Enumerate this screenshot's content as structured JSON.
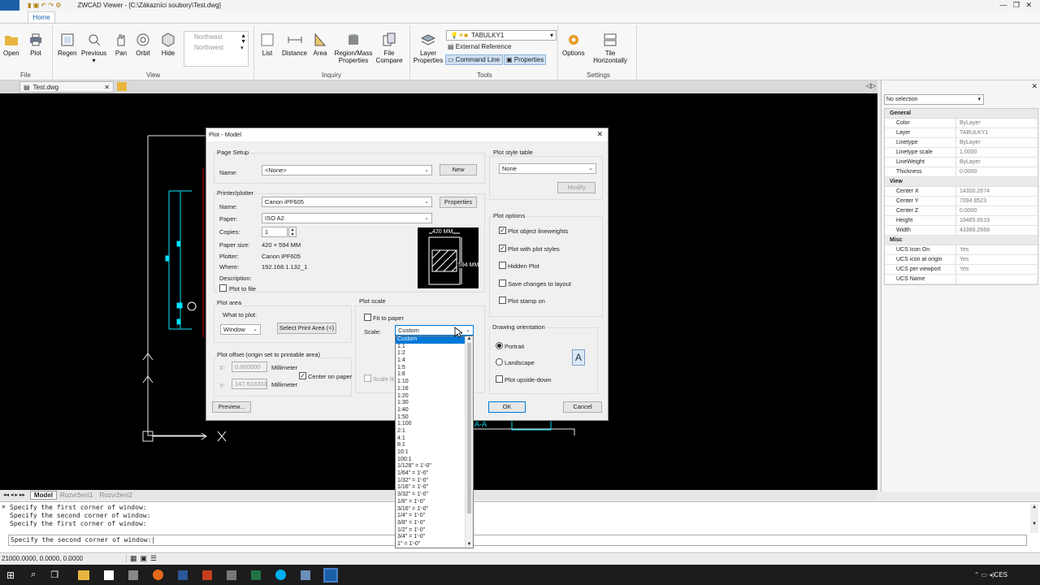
{
  "window": {
    "title": "ZWCAD Viewer - [C:\\Zákazníci soubory\\Test.dwg]"
  },
  "ribbon": {
    "tab": "Home",
    "buttons": {
      "open": "Open",
      "plot": "Plot",
      "regen": "Regen",
      "previous": "Previous",
      "pan": "Pan",
      "orbit": "Orbit",
      "hide": "Hide",
      "list": "List",
      "distance": "Distance",
      "area": "Area",
      "region_mass": "Region/Mass\nProperties",
      "file_compare": "File\nCompare",
      "layer_properties": "Layer\nProperties",
      "options": "Options",
      "tile": "Tile\nHorizontally"
    },
    "views": [
      "Northeast",
      "Northwest"
    ],
    "layer_value": "TABULKY1",
    "external_reference": "External Reference",
    "command_line": "Command Line",
    "properties": "Properties",
    "groups": {
      "file": "File",
      "view": "View",
      "inquiry": "Inquiry",
      "tools": "Tools",
      "settings": "Settings"
    }
  },
  "doc_tab": "Test.dwg",
  "properties_panel": {
    "selection": "No selection",
    "sections": [
      {
        "name": "General",
        "rows": [
          [
            "Color",
            "ByLayer"
          ],
          [
            "Layer",
            "TABULKY1"
          ],
          [
            "Linetype",
            "ByLayer"
          ],
          [
            "Linetype scale",
            "1.0000"
          ],
          [
            "LineWeight",
            "ByLayer"
          ],
          [
            "Thickness",
            "0.0000"
          ]
        ]
      },
      {
        "name": "View",
        "rows": [
          [
            "Center X",
            "14300.2674"
          ],
          [
            "Center Y",
            "7094.8523"
          ],
          [
            "Center Z",
            "0.0000"
          ],
          [
            "Height",
            "19465.6519"
          ],
          [
            "Width",
            "43388.2668"
          ]
        ]
      },
      {
        "name": "Misc",
        "rows": [
          [
            "UCS Icon On",
            "Yes"
          ],
          [
            "UCS icon at origin",
            "Yes"
          ],
          [
            "UCS per viewport",
            "Yes"
          ],
          [
            "UCS Name",
            ""
          ]
        ]
      }
    ]
  },
  "layout_tabs": [
    "Model",
    "Rozvržení1",
    "Rozvržení2"
  ],
  "command": {
    "history": [
      "Specify the first corner of window:",
      "Specify the second corner of window:",
      "Specify the first corner of window:"
    ],
    "prompt": "Specify the second corner of window:"
  },
  "status": {
    "coords": "21000.0000, 0.0000, 0.0000"
  },
  "dialog": {
    "title": "Plot - Model",
    "page_setup": {
      "group": "Page Setup",
      "name_label": "Name:",
      "name_value": "<None>",
      "new_btn": "New"
    },
    "printer": {
      "group": "Printer/plotter",
      "name_label": "Name:",
      "name_value": "Canon iPF605",
      "properties_btn": "Properties",
      "paper_label": "Paper:",
      "paper_value": "ISO A2",
      "copies_label": "Copies:",
      "copies_value": "1",
      "size_label": "Paper size:",
      "size_value": "420 × 594  MM",
      "plotter_label": "Plotter:",
      "plotter_value": "Canon iPF605",
      "where_label": "Where:",
      "where_value": "192.168.1.132_1",
      "desc_label": "Description:",
      "plot_to_file": "Plot to file",
      "preview_w": "420 MM",
      "preview_h": "594 MM"
    },
    "plot_area": {
      "group": "Plot area",
      "what_label": "What to plot:",
      "what_value": "Window",
      "select_btn": "Select Print Area (<)"
    },
    "plot_offset": {
      "group": "Plot offset (origin set to printable area)",
      "x_label": "X:",
      "x_value": "0.000000",
      "x_unit": "Millimeter",
      "y_label": "Y:",
      "y_value": "147.616333",
      "y_unit": "Millimeter",
      "center": "Center on paper"
    },
    "plot_scale": {
      "group": "Plot scale",
      "fit": "Fit to paper",
      "scale_label": "Scale:",
      "scale_value": "Custom",
      "scale_lineweights": "Scale lineweights"
    },
    "style_table": {
      "group": "Plot style table",
      "value": "None",
      "modify_btn": "Modify"
    },
    "options": {
      "group": "Plot options",
      "items": [
        [
          "Plot object lineweights",
          true
        ],
        [
          "Plot with plot styles",
          true
        ],
        [
          "Hidden Plot",
          false
        ],
        [
          "Save changes to layout",
          false
        ],
        [
          "Plot stamp on",
          false
        ]
      ]
    },
    "orientation": {
      "group": "Drawing orientation",
      "portrait": "Portrait",
      "landscape": "Landscape",
      "upside": "Plot upside-down",
      "icon_letter": "A"
    },
    "preview_btn": "Preview...",
    "ok_btn": "OK",
    "cancel_btn": "Cancel"
  },
  "scale_options": [
    "Custom",
    "1:1",
    "1:2",
    "1:4",
    "1:5",
    "1:8",
    "1:10",
    "1:16",
    "1:20",
    "1:30",
    "1:40",
    "1:50",
    "1:100",
    "2:1",
    "4:1",
    "8:1",
    "10:1",
    "100:1",
    "1/128\" = 1'-0\"",
    "1/64\" = 1'-0\"",
    "1/32\" = 1'-0\"",
    "1/16\" = 1'-0\"",
    "3/32\" = 1'-0\"",
    "1/8\" = 1'-0\"",
    "3/16\" = 1'-0\"",
    "1/4\" = 1'-0\"",
    "3/8\" = 1'-0\"",
    "1/2\" = 1'-0\"",
    "3/4\" = 1'-0\"",
    "1\" = 1'-0\""
  ],
  "canvas_label": "A-A",
  "taskbar": {
    "tray": "CES"
  },
  "colors": {
    "accent": "#0078d7",
    "canvas": "#000000",
    "cyan": "#00e5ff"
  }
}
